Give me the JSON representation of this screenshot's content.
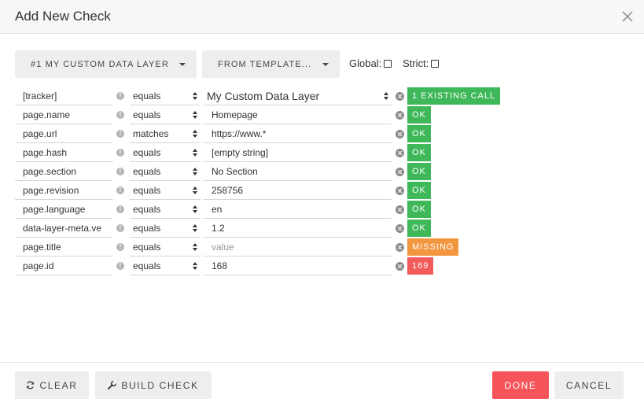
{
  "dialog": {
    "title": "Add New Check",
    "close_icon": "close-icon"
  },
  "toolbar": {
    "data_layer_label": "#1 MY CUSTOM DATA LAYER",
    "template_label": "FROM TEMPLATE...",
    "global_label": "Global:",
    "strict_label": "Strict:",
    "global_checked": false,
    "strict_checked": false
  },
  "rows": [
    {
      "key": "[tracker]",
      "op": "equals",
      "value": "My Custom Data Layer",
      "value_is_select": true,
      "status": "1 EXISTING CALL",
      "status_type": "ok"
    },
    {
      "key": "page.name",
      "op": "equals",
      "value": "Homepage",
      "status": "OK",
      "status_type": "ok"
    },
    {
      "key": "page.url",
      "op": "matches",
      "value": "https://www.*",
      "status": "OK",
      "status_type": "ok"
    },
    {
      "key": "page.hash",
      "op": "equals",
      "value": "[empty string]",
      "status": "OK",
      "status_type": "ok"
    },
    {
      "key": "page.section",
      "op": "equals",
      "value": "No Section",
      "status": "OK",
      "status_type": "ok"
    },
    {
      "key": "page.revision",
      "op": "equals",
      "value": "258756",
      "status": "OK",
      "status_type": "ok"
    },
    {
      "key": "page.language",
      "op": "equals",
      "value": "en",
      "status": "OK",
      "status_type": "ok"
    },
    {
      "key": "data-layer-meta.ve",
      "op": "equals",
      "value": "1.2",
      "status": "OK",
      "status_type": "ok"
    },
    {
      "key": "page.title",
      "op": "equals",
      "value": "",
      "placeholder": "value",
      "status": "MISSING",
      "status_type": "missing"
    },
    {
      "key": "page.id",
      "op": "equals",
      "value": "168",
      "status": "169",
      "status_type": "error"
    }
  ],
  "row_icons": {
    "warning_icon": "exclamation-icon",
    "warning_glyph": "!",
    "remove_icon": "remove-circle-icon"
  },
  "colors": {
    "ok": "#3fb85a",
    "missing": "#f39640",
    "error": "#f35a5a",
    "done_button": "#f5545a"
  },
  "footer": {
    "clear_label": "CLEAR",
    "build_label": "BUILD CHECK",
    "done_label": "DONE",
    "cancel_label": "CANCEL",
    "clear_icon": "refresh-icon",
    "build_icon": "wrench-icon"
  }
}
